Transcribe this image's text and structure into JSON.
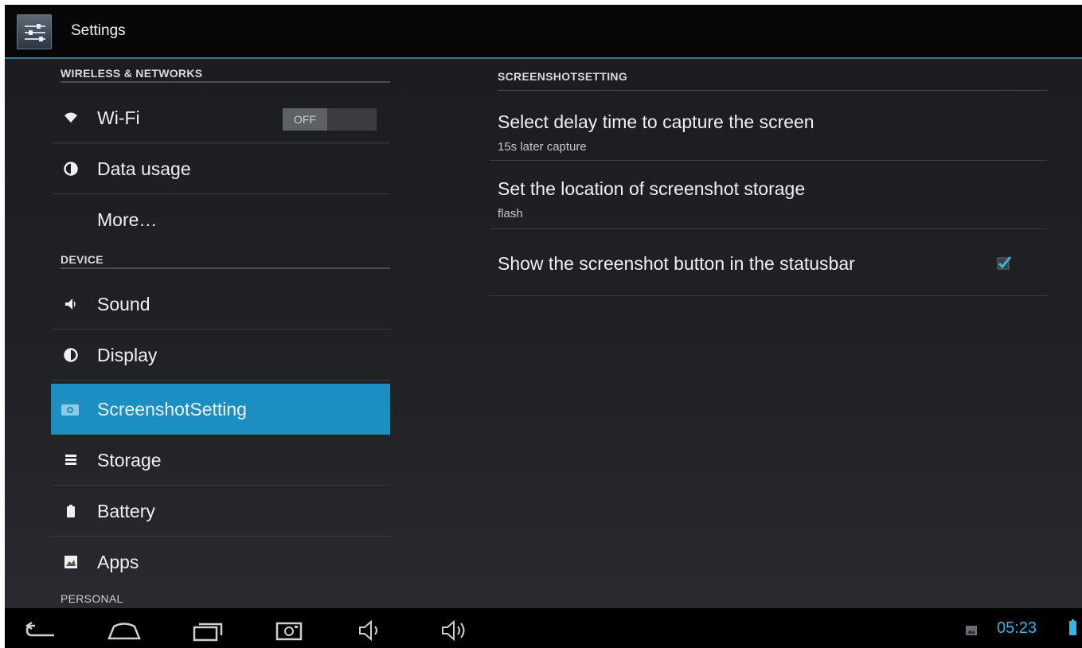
{
  "actionbar": {
    "title": "Settings",
    "icon": "settings-sliders-icon"
  },
  "left": {
    "headers": {
      "wireless": "WIRELESS & NETWORKS",
      "device": "DEVICE",
      "personal": "PERSONAL"
    },
    "items": [
      {
        "label": "Wi-Fi",
        "icon": "wifi-icon"
      },
      {
        "label": "Data usage",
        "icon": "data-usage-icon"
      },
      {
        "label": "More…",
        "icon": ""
      },
      {
        "label": "Sound",
        "icon": "speaker-icon"
      },
      {
        "label": "Display",
        "icon": "display-icon"
      },
      {
        "label": "ScreenshotSetting",
        "icon": "camera-icon",
        "selected": true
      },
      {
        "label": "Storage",
        "icon": "storage-icon"
      },
      {
        "label": "Battery",
        "icon": "battery-icon"
      },
      {
        "label": "Apps",
        "icon": "apps-icon"
      }
    ],
    "wifi_toggle": "OFF"
  },
  "right": {
    "header": "SCREENSHOTSETTING",
    "items": [
      {
        "title": "Select delay time to capture the screen",
        "summary": "15s later capture"
      },
      {
        "title": "Set the location of screenshot storage",
        "summary": "flash"
      },
      {
        "title": "Show the screenshot button in the statusbar",
        "checked": true
      }
    ]
  },
  "navbar": {
    "buttons": [
      "back-icon",
      "home-icon",
      "recent-apps-icon",
      "screenshot-icon",
      "volume-down-icon",
      "volume-up-icon"
    ],
    "clock": "05:23"
  },
  "colors": {
    "accent": "#33b5e5",
    "selected": "#1b8fc2"
  }
}
